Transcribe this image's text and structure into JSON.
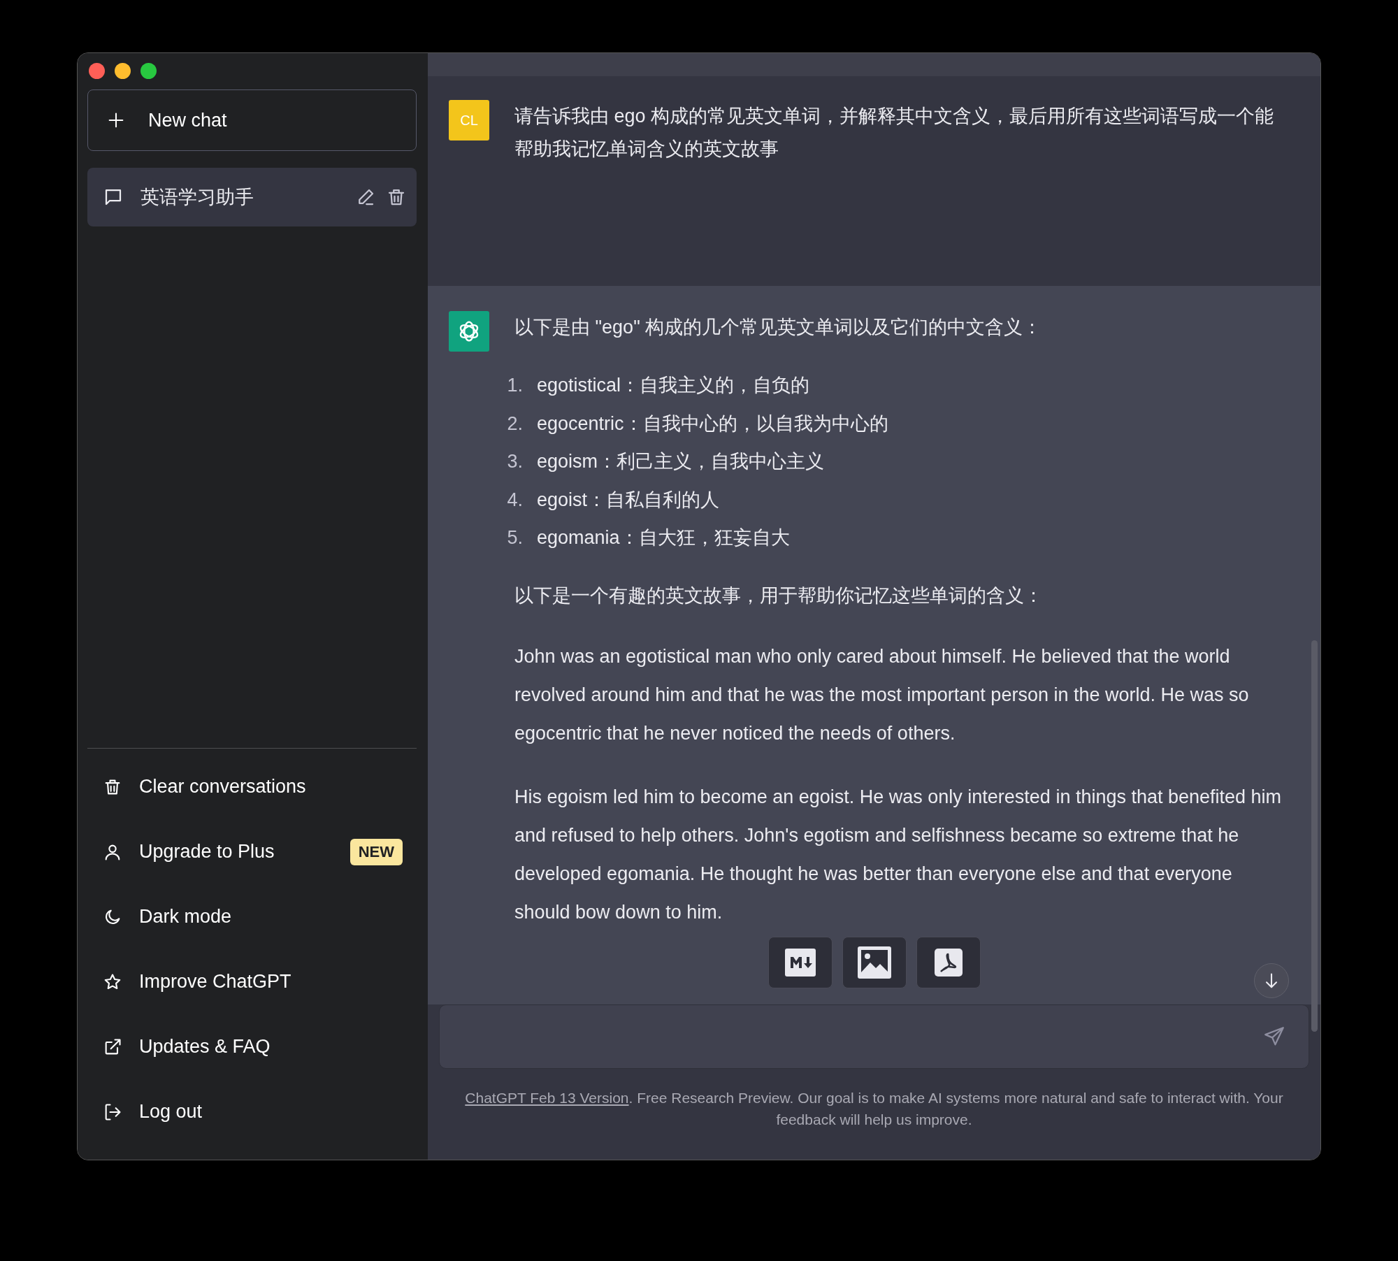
{
  "sidebar": {
    "new_chat": "New chat",
    "conversations": [
      {
        "title": "英语学习助手",
        "selected": true
      }
    ],
    "menu": [
      {
        "kind": "trash",
        "label": "Clear conversations"
      },
      {
        "kind": "user",
        "label": "Upgrade to Plus",
        "badge": "NEW"
      },
      {
        "kind": "moon",
        "label": "Dark mode"
      },
      {
        "kind": "star",
        "label": "Improve ChatGPT"
      },
      {
        "kind": "external",
        "label": "Updates & FAQ"
      },
      {
        "kind": "logout",
        "label": "Log out"
      }
    ]
  },
  "messages": [
    {
      "kind": "user",
      "avatar": "CL",
      "blocks": [
        {
          "kind": "para",
          "text": "请告诉我由 ego 构成的常见英文单词，并解释其中文含义，最后用所有这些词语写成一个能帮助我记忆单词含义的英文故事"
        }
      ]
    },
    {
      "kind": "assistant",
      "blocks": [
        {
          "kind": "para",
          "text": "以下是由 \"ego\" 构成的几个常见英文单词以及它们的中文含义："
        },
        {
          "kind": "list",
          "items": [
            {
              "number": "1.",
              "text": "egotistical：自我主义的，自负的"
            },
            {
              "number": "2.",
              "text": "egocentric：自我中心的，以自我为中心的"
            },
            {
              "number": "3.",
              "text": "egoism：利己主义，自我中心主义"
            },
            {
              "number": "4.",
              "text": "egoist：自私自利的人"
            },
            {
              "number": "5.",
              "text": "egomania：自大狂，狂妄自大"
            }
          ]
        },
        {
          "kind": "para",
          "text": "以下是一个有趣的英文故事，用于帮助你记忆这些单词的含义："
        },
        {
          "kind": "para",
          "text": "John was an egotistical man who only cared about himself. He believed that the world revolved around him and that he was the most important person in the world. He was so egocentric that he never noticed the needs of others."
        },
        {
          "kind": "para",
          "text": "His egoism led him to become an egoist. He was only interested in things that benefited him and refused to help others. John's egotism and selfishness became so extreme that he developed egomania. He thought he was better than everyone else and that everyone should bow down to him."
        }
      ]
    }
  ],
  "footer": {
    "link": "ChatGPT Feb 13 Version",
    "text": ". Free Research Preview. Our goal is to make AI systems more natural and safe to interact with. Your feedback will help us improve."
  }
}
